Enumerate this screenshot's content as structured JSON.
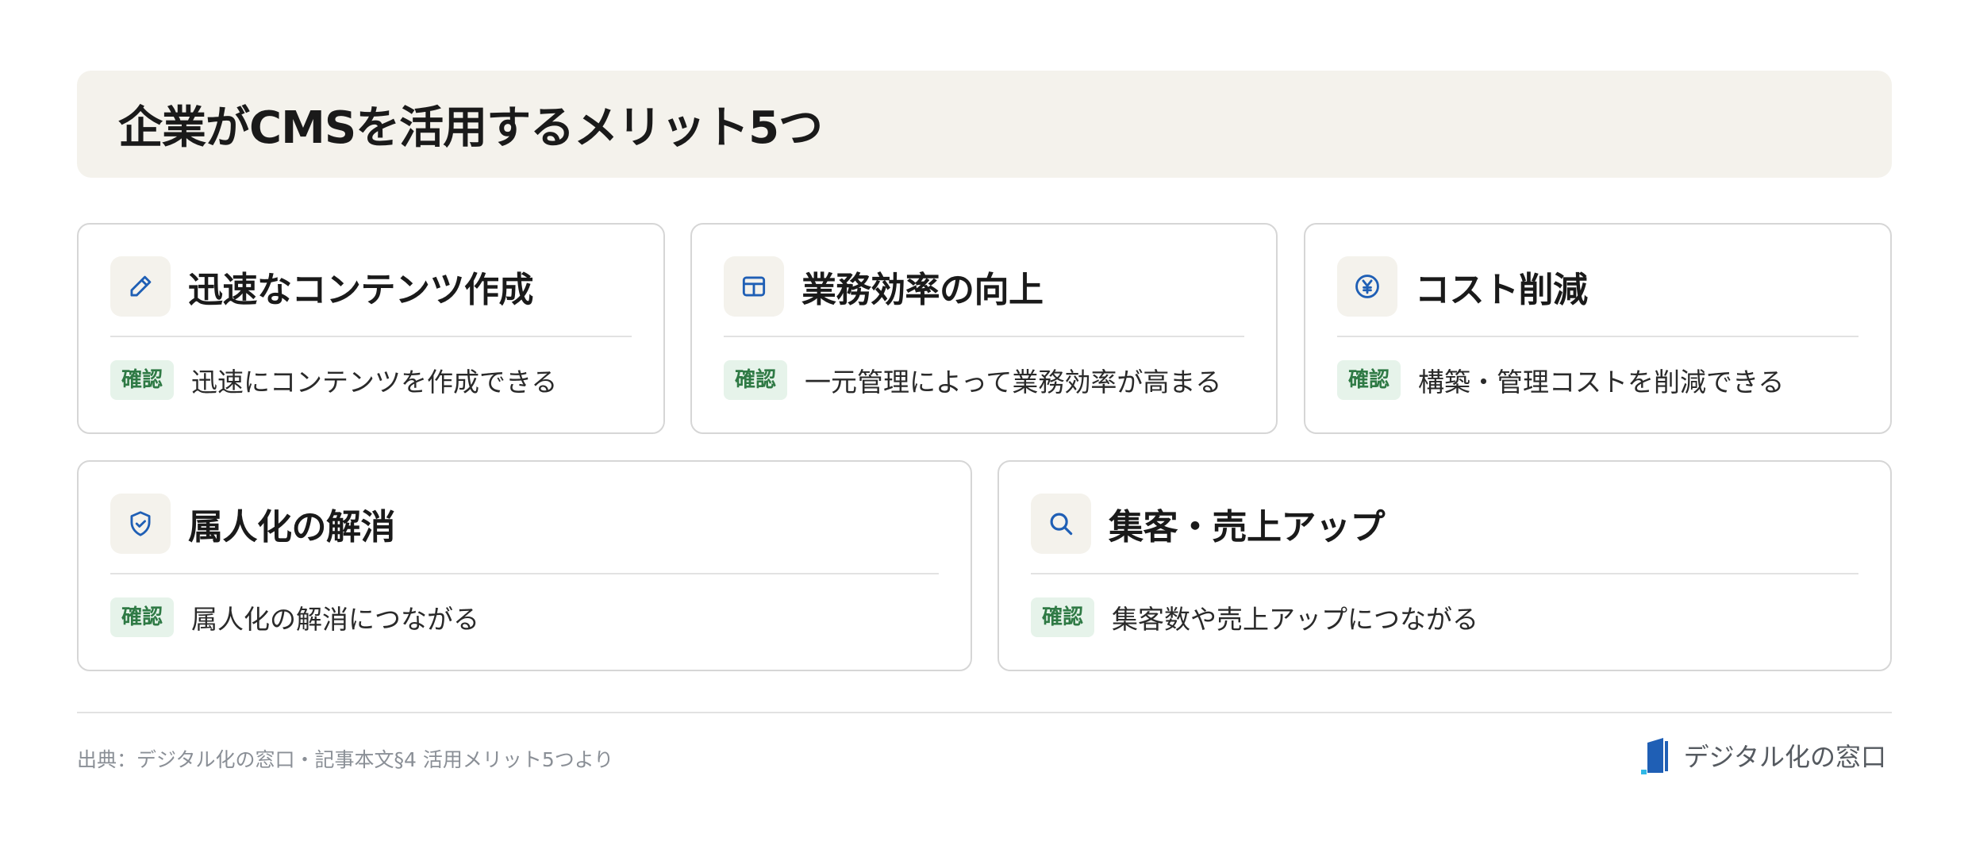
{
  "title": "企業がCMSを活用するメリット5つ",
  "cards": [
    {
      "icon": "pencil-icon",
      "title": "迅速なコンテンツ作成",
      "badge": "確認",
      "text": "迅速にコンテンツを作成できる"
    },
    {
      "icon": "grid-table-icon",
      "title": "業務効率の向上",
      "badge": "確認",
      "text": "一元管理によって業務効率が高まる"
    },
    {
      "icon": "yen-coin-icon",
      "title": "コスト削減",
      "badge": "確認",
      "text": "構築・管理コストを削減できる"
    },
    {
      "icon": "shield-check-icon",
      "title": "属人化の解消",
      "badge": "確認",
      "text": "属人化の解消につながる"
    },
    {
      "icon": "search-icon",
      "title": "集客・売上アップ",
      "badge": "確認",
      "text": "集客数や売上アップにつながる"
    }
  ],
  "footer": {
    "source": "出典：デジタル化の窓口・記事本文§4 活用メリット5つより",
    "brand": "デジタル化の窓口"
  },
  "colors": {
    "accent": "#1f5fb5",
    "banner_bg": "#f4f2ec",
    "badge_bg": "#e6f3ea",
    "badge_text": "#2f7a45"
  }
}
